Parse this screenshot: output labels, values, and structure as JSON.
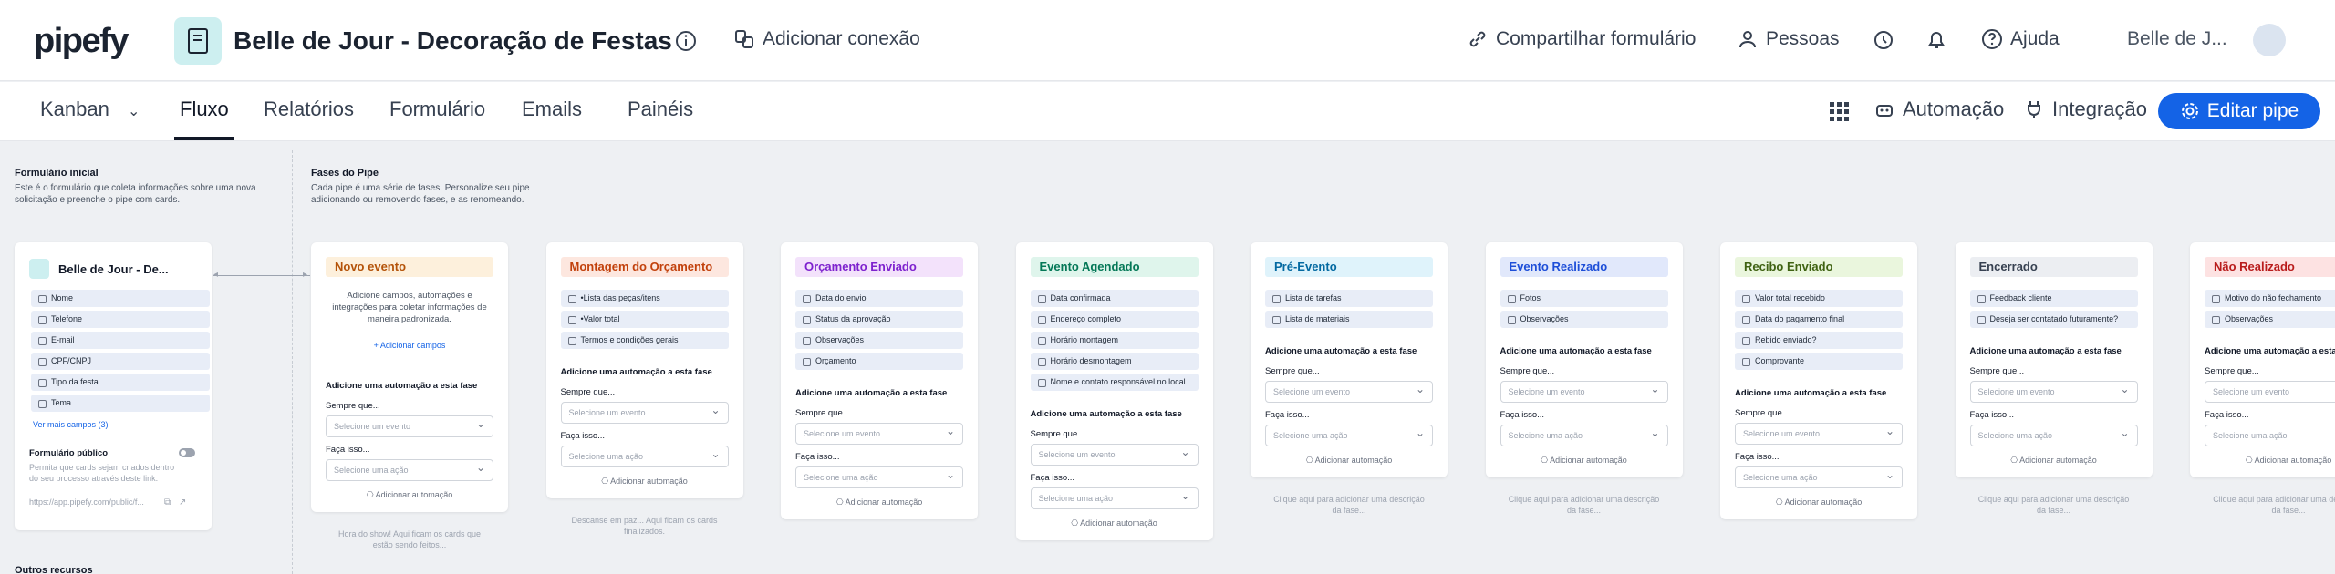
{
  "header": {
    "logo": "pipefy",
    "pipe_title": "Belle de Jour - Decoração de Festas",
    "add_connection": "Adicionar conexão",
    "share_form": "Compartilhar formulário",
    "people": "Pessoas",
    "help": "Ajuda",
    "user": "Belle de J..."
  },
  "tabs": {
    "kanban": "Kanban",
    "fluxo": "Fluxo",
    "relatorios": "Relatórios",
    "formulario": "Formulário",
    "emails": "Emails",
    "paineis": "Painéis",
    "automacao": "Automação",
    "integracao": "Integração",
    "editar": "Editar pipe"
  },
  "start": {
    "section_title": "Formulário inicial",
    "section_desc_1": "Este é o formulário que coleta informações sobre uma nova",
    "section_desc_2": "solicitação e preenche o pipe com cards.",
    "card_title": "Belle de Jour - De...",
    "fields": [
      "Nome",
      "Telefone",
      "E-mail",
      "CPF/CNPJ",
      "Tipo da festa",
      "Tema"
    ],
    "more_fields": "Ver mais campos (3)",
    "public_form": "Formulário público",
    "public_desc_1": "Permita que cards sejam criados dentro",
    "public_desc_2": "do seu processo através deste link.",
    "public_link": "https://app.pipefy.com/public/f...",
    "other_resources": "Outros recursos"
  },
  "phases_section": {
    "title": "Fases do Pipe",
    "desc_1": "Cada pipe é uma série de fases. Personalize seu pipe",
    "desc_2": "adicionando ou removendo fases, e as renomeando."
  },
  "common": {
    "add_auto_title": "Adicione uma automação a esta fase",
    "always": "Sempre que...",
    "select_event": "Selecione um evento",
    "do_this": "Faça isso...",
    "select_action": "Selecione uma ação",
    "add_automation": "Adicionar automação",
    "empty_desc_1": "Adicione campos, automações e",
    "empty_desc_2": "integrações para coletar informações de",
    "empty_desc_3": "maneira padronizada.",
    "add_fields": "Adicionar campos",
    "add_phase_desc_1": "Clique aqui para adicionar uma descrição",
    "add_phase_desc_2": "da fase..."
  },
  "phases": [
    {
      "name": "Novo evento",
      "color": "#fdf0dc",
      "text_color": "#b45309",
      "fields": [],
      "footer_1": "Hora do show! Aqui ficam os cards que",
      "footer_2": "estão sendo feitos..."
    },
    {
      "name": "Montagem do Orçamento",
      "color": "#fde7df",
      "text_color": "#c2410c",
      "fields": [
        "•Lista das peças/itens",
        "•Valor total",
        "Termos e condições gerais"
      ],
      "footer_1": "Descanse em paz... Aqui ficam os cards",
      "footer_2": "finalizados."
    },
    {
      "name": "Orçamento Enviado",
      "color": "#f3e2fb",
      "text_color": "#7e22ce",
      "fields": [
        "Data do envio",
        "Status da aprovação",
        "Observações",
        "Orçamento"
      ],
      "footer_1": "",
      "footer_2": ""
    },
    {
      "name": "Evento Agendado",
      "color": "#dff5ec",
      "text_color": "#047857",
      "fields": [
        "Data confirmada",
        "Endereço completo",
        "Horário montagem",
        "Horário desmontagem",
        "Nome e contato responsável no local"
      ],
      "footer_1": "",
      "footer_2": ""
    },
    {
      "name": "Pré-Evento",
      "color": "#dff3fb",
      "text_color": "#0369a1",
      "fields": [
        "Lista de tarefas",
        "Lista de materiais"
      ],
      "footer_1": "Clique aqui para adicionar uma descrição",
      "footer_2": "da fase..."
    },
    {
      "name": "Evento Realizado",
      "color": "#e1e8fb",
      "text_color": "#1d4ed8",
      "fields": [
        "Fotos",
        "Observações"
      ],
      "footer_1": "Clique aqui para adicionar uma descrição",
      "footer_2": "da fase..."
    },
    {
      "name": "Recibo Enviado",
      "color": "#eaf6dd",
      "text_color": "#3f6212",
      "fields": [
        "Valor total recebido",
        "Data do pagamento final",
        "Rebido enviado?",
        "Comprovante"
      ],
      "footer_1": "",
      "footer_2": ""
    },
    {
      "name": "Encerrado",
      "color": "#eceef2",
      "text_color": "#374151",
      "fields": [
        "Feedback cliente",
        "Deseja ser contatado futuramente?"
      ],
      "footer_1": "Clique aqui para adicionar uma descrição",
      "footer_2": "da fase..."
    },
    {
      "name": "Não Realizado",
      "color": "#fde2e2",
      "text_color": "#b91c1c",
      "fields": [
        "Motivo do não fechamento",
        "Observações"
      ],
      "footer_1": "Clique aqui para adicionar uma descrição",
      "footer_2": "da fase..."
    }
  ]
}
